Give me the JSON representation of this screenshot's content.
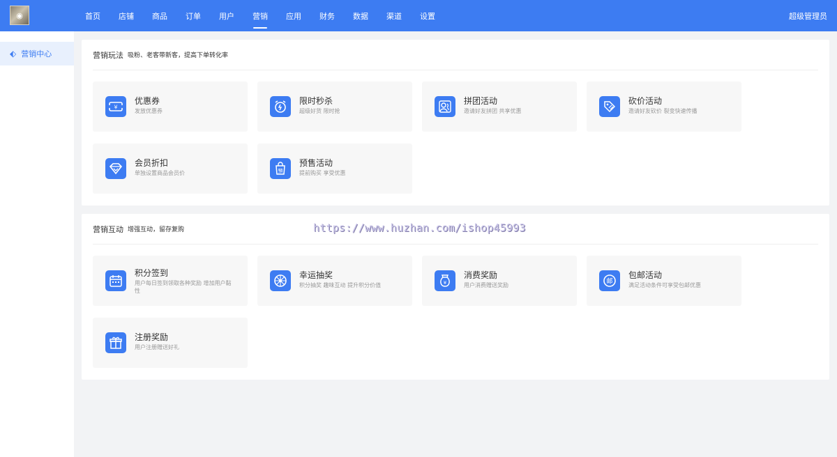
{
  "topbar": {
    "logo_text": "◉",
    "nav": [
      {
        "label": "首页"
      },
      {
        "label": "店铺"
      },
      {
        "label": "商品"
      },
      {
        "label": "订单"
      },
      {
        "label": "用户"
      },
      {
        "label": "营销",
        "active": true
      },
      {
        "label": "应用"
      },
      {
        "label": "财务"
      },
      {
        "label": "数据"
      },
      {
        "label": "渠道"
      },
      {
        "label": "设置"
      }
    ],
    "admin_label": "超级管理员"
  },
  "sidebar": {
    "items": [
      {
        "label": "营销中心",
        "icon": "tag-icon",
        "glyph": "⬖"
      }
    ]
  },
  "sections": [
    {
      "title": "营销玩法",
      "subtitle": "吸粉、老客带新客，提高下单转化率",
      "cards": [
        {
          "title": "优惠券",
          "desc": "发放优惠券",
          "icon": "coupon-icon"
        },
        {
          "title": "限时秒杀",
          "desc": "超级好货 限时抢",
          "icon": "alarm-clock-icon"
        },
        {
          "title": "拼团活动",
          "desc": "邀请好友拼团 共享优惠",
          "icon": "group-users-icon"
        },
        {
          "title": "砍价活动",
          "desc": "邀请好友砍价 裂变快速传播",
          "icon": "price-tag-icon"
        },
        {
          "title": "会员折扣",
          "desc": "单独设置商品会员价",
          "icon": "diamond-icon"
        },
        {
          "title": "预售活动",
          "desc": "提前购买 享受优惠",
          "icon": "presale-bag-icon"
        }
      ]
    },
    {
      "title": "营销互动",
      "subtitle": "增强互动，留存复购",
      "cards": [
        {
          "title": "积分签到",
          "desc": "用户每日签到领取各种奖励 增加用户黏性",
          "icon": "calendar-icon"
        },
        {
          "title": "幸运抽奖",
          "desc": "积分抽奖 趣味互动 提升积分价值",
          "icon": "wheel-icon"
        },
        {
          "title": "消费奖励",
          "desc": "用户消费赠送奖励",
          "icon": "money-bag-icon"
        },
        {
          "title": "包邮活动",
          "desc": "满足活动条件可享受包邮优惠",
          "icon": "postage-icon"
        },
        {
          "title": "注册奖励",
          "desc": "用户注册赠送好礼",
          "icon": "gift-icon"
        }
      ]
    }
  ],
  "watermark": "https://www.huzhan.com/ishop45993",
  "colors": {
    "primary": "#3d7cf2",
    "page_bg": "#f2f3f5",
    "card_bg": "#f7f7f7",
    "sidebar_active_bg": "#e8f0fd"
  }
}
